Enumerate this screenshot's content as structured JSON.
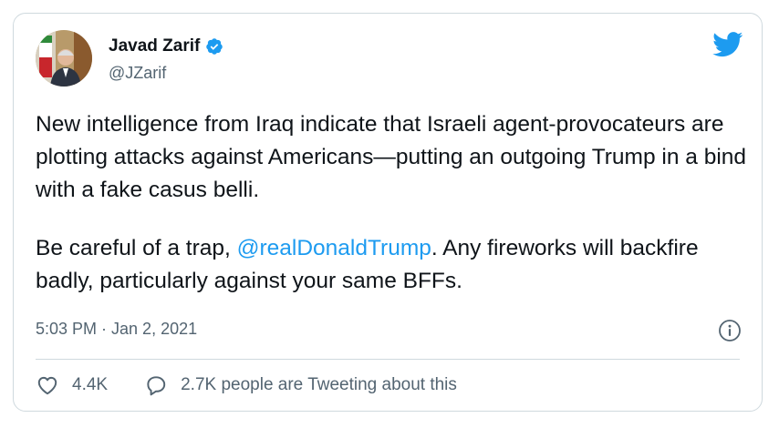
{
  "user": {
    "display_name": "Javad Zarif",
    "handle": "@JZarif",
    "verified": true
  },
  "tweet": {
    "paragraph1": "New intelligence from Iraq indicate that Israeli agent-provocateurs are plotting attacks against Americans—putting an outgoing Trump in a bind with a fake casus belli.",
    "paragraph2_before": "Be careful of a trap, ",
    "mention": "@realDonaldTrump",
    "paragraph2_after": ". Any fireworks will backfire badly, particularly against your same BFFs.",
    "timestamp": "5:03 PM · Jan 2, 2021"
  },
  "actions": {
    "like_count": "4.4K",
    "reply_label": "2.7K people are Tweeting about this"
  },
  "icons": {
    "brand": "twitter-bird-icon",
    "verified": "verified-badge-icon",
    "info": "info-icon",
    "like": "heart-icon",
    "reply": "speech-bubble-icon"
  },
  "colors": {
    "accent": "#1d9bf0",
    "text": "#0f1419",
    "muted": "#536471",
    "border": "#cfd9de"
  }
}
